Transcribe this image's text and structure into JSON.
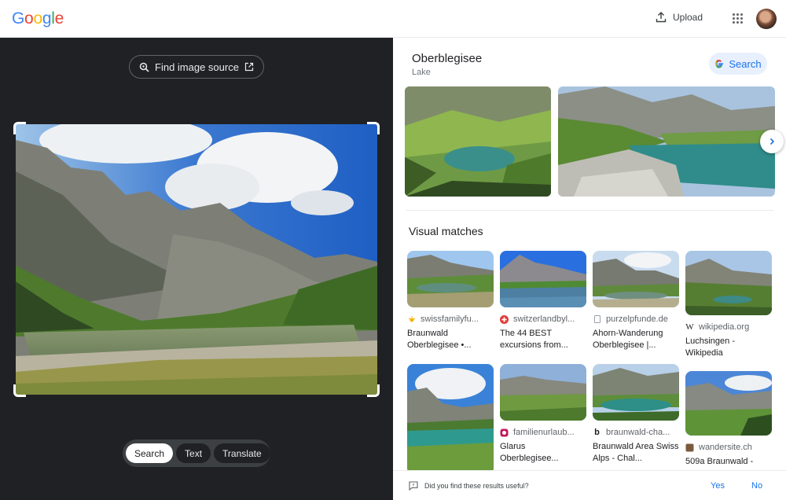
{
  "header": {
    "logo_letters": [
      "G",
      "o",
      "o",
      "g",
      "l",
      "e"
    ],
    "upload_label": "Upload"
  },
  "left": {
    "find_source_label": "Find image source",
    "modes": [
      "Search",
      "Text",
      "Translate"
    ],
    "active_mode": "Search"
  },
  "knowledge": {
    "title": "Oberblegisee",
    "subtitle": "Lake",
    "search_label": "Search"
  },
  "visual_matches": {
    "heading": "Visual matches",
    "items": [
      {
        "source": "swissfamilyfu...",
        "caption": "Braunwald Oberblegisee •..."
      },
      {
        "source": "switzerlandbyl...",
        "caption": "The 44 BEST excursions from..."
      },
      {
        "source": "purzelpfunde.de",
        "caption": "Ahorn-Wanderung Oberblegisee |..."
      },
      {
        "source": "wikipedia.org",
        "caption": "Luchsingen - Wikipedia"
      },
      {
        "source": "",
        "caption": ""
      },
      {
        "source": "familienurlaub...",
        "caption": "Glarus Oberblegisee..."
      },
      {
        "source": "braunwald-cha...",
        "caption": "Braunwald Area Swiss Alps - Chal..."
      },
      {
        "source": "wandersite.ch",
        "caption": "509a Braunwald -"
      }
    ]
  },
  "feedback": {
    "question": "Did you find these results useful?",
    "yes": "Yes",
    "no": "No"
  },
  "colors": {
    "accent": "#1a73e8",
    "dark_panel": "#202124",
    "chip_bg": "#e8f0fe"
  }
}
